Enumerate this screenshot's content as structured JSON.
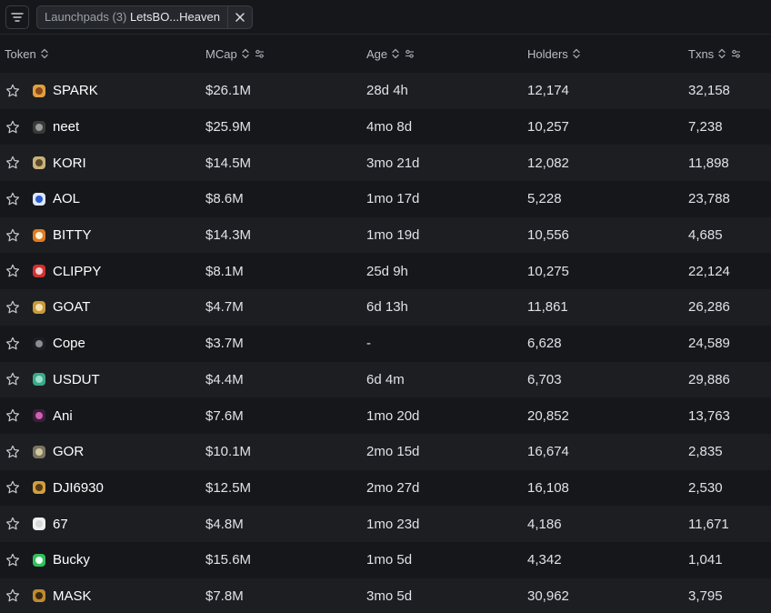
{
  "filter_bar": {
    "chip_label_muted": "Launchpads (3) ",
    "chip_label_selected": "LetsBO...Heaven"
  },
  "table": {
    "headers": {
      "token": "Token",
      "mcap": "MCap",
      "age": "Age",
      "holders": "Holders",
      "txns": "Txns"
    },
    "rows": [
      {
        "name": "SPARK",
        "mcap": "$26.1M",
        "age": "28d 4h",
        "holders": "12,174",
        "txns": "32,158",
        "logo_color": "#e0a040",
        "logo_inner": "#8a4a1a"
      },
      {
        "name": "neet",
        "mcap": "$25.9M",
        "age": "4mo 8d",
        "holders": "10,257",
        "txns": "7,238",
        "logo_color": "#3a3a3a",
        "logo_inner": "#9a9a9a"
      },
      {
        "name": "KORI",
        "mcap": "$14.5M",
        "age": "3mo 21d",
        "holders": "12,082",
        "txns": "11,898",
        "logo_color": "#c9b27a",
        "logo_inner": "#5a4a2a"
      },
      {
        "name": "AOL",
        "mcap": "$8.6M",
        "age": "1mo 17d",
        "holders": "5,228",
        "txns": "23,788",
        "logo_color": "#dfe6f5",
        "logo_inner": "#2a5bd0"
      },
      {
        "name": "BITTY",
        "mcap": "$14.3M",
        "age": "1mo 19d",
        "holders": "10,556",
        "txns": "4,685",
        "logo_color": "#e07a20",
        "logo_inner": "#fff0d0"
      },
      {
        "name": "CLIPPY",
        "mcap": "$8.1M",
        "age": "25d 9h",
        "holders": "10,275",
        "txns": "22,124",
        "logo_color": "#d43030",
        "logo_inner": "#f0d0d0"
      },
      {
        "name": "GOAT",
        "mcap": "$4.7M",
        "age": "6d 13h",
        "holders": "11,861",
        "txns": "26,286",
        "logo_color": "#c89a3a",
        "logo_inner": "#f5e0b0"
      },
      {
        "name": "Cope",
        "mcap": "$3.7M",
        "age": "-",
        "holders": "6,628",
        "txns": "24,589",
        "logo_color": "#1d1e22",
        "logo_inner": "#8a8d94"
      },
      {
        "name": "USDUT",
        "mcap": "$4.4M",
        "age": "6d 4m",
        "holders": "6,703",
        "txns": "29,886",
        "logo_color": "#3aaa88",
        "logo_inner": "#9ae0c8"
      },
      {
        "name": "Ani",
        "mcap": "$7.6M",
        "age": "1mo 20d",
        "holders": "20,852",
        "txns": "13,763",
        "logo_color": "#3a1f3a",
        "logo_inner": "#d060b0"
      },
      {
        "name": "GOR",
        "mcap": "$10.1M",
        "age": "2mo 15d",
        "holders": "16,674",
        "txns": "2,835",
        "logo_color": "#7a7560",
        "logo_inner": "#d0c8a0"
      },
      {
        "name": "DJI6930",
        "mcap": "$12.5M",
        "age": "2mo 27d",
        "holders": "16,108",
        "txns": "2,530",
        "logo_color": "#d0a040",
        "logo_inner": "#5a3a10"
      },
      {
        "name": "67",
        "mcap": "$4.8M",
        "age": "1mo 23d",
        "holders": "4,186",
        "txns": "11,671",
        "logo_color": "#f0f0f0",
        "logo_inner": "#d8d8d8"
      },
      {
        "name": "Bucky",
        "mcap": "$15.6M",
        "age": "1mo 5d",
        "holders": "4,342",
        "txns": "1,041",
        "logo_color": "#30c060",
        "logo_inner": "#e8ffe8"
      },
      {
        "name": "MASK",
        "mcap": "$7.8M",
        "age": "3mo 5d",
        "holders": "30,962",
        "txns": "3,795",
        "logo_color": "#c08a30",
        "logo_inner": "#3a2a10"
      }
    ]
  },
  "colors": {
    "background": "#16171a",
    "row_alt": "#1d1e22",
    "text": "#dfe2e7",
    "muted": "#9aa0a8"
  }
}
